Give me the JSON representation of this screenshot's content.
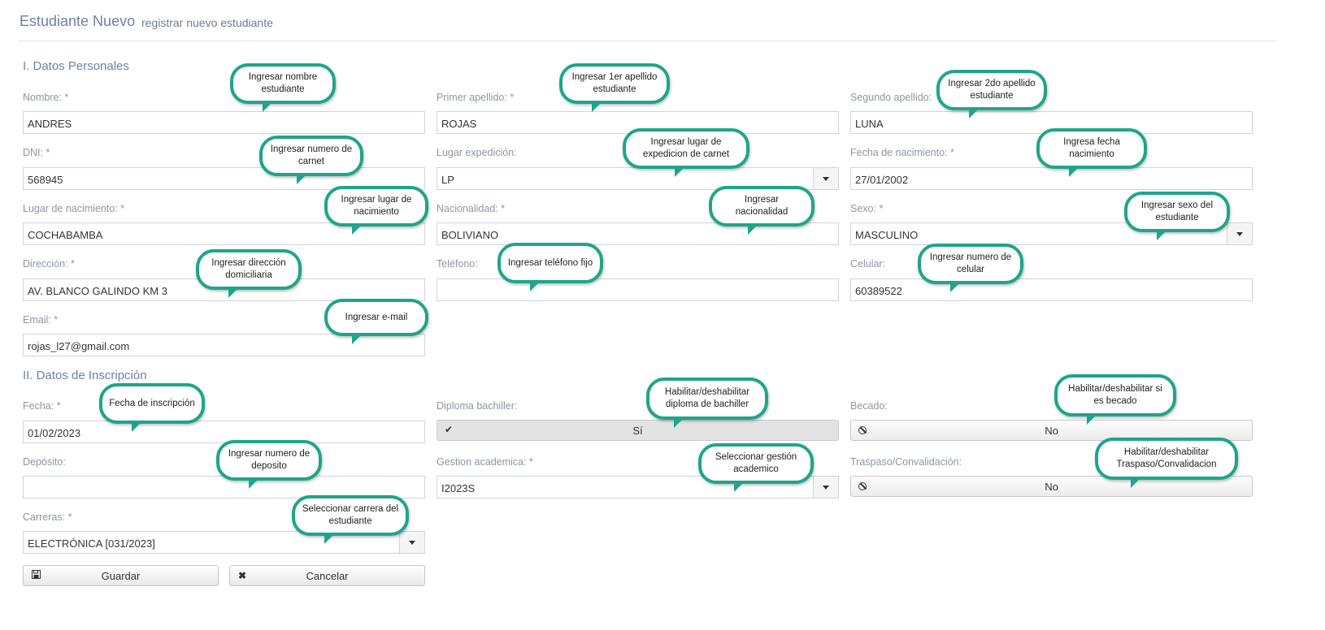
{
  "header": {
    "title": "Estudiante Nuevo",
    "subtitle": "registrar nuevo estudiante"
  },
  "sections": {
    "personal": "I. Datos Personales",
    "inscripcion": "II. Datos de Inscripción"
  },
  "fields": {
    "nombre": {
      "label": "Nombre: *",
      "value": "ANDRES"
    },
    "primer_apellido": {
      "label": "Primer apellido: *",
      "value": "ROJAS"
    },
    "segundo_apellido": {
      "label": "Segundo apellido:",
      "value": "LUNA"
    },
    "dni": {
      "label": "DNI: *",
      "value": "568945"
    },
    "lugar_expedicion": {
      "label": "Lugar expedición:",
      "value": "LP"
    },
    "fecha_nacimiento": {
      "label": "Fecha de nacimiento: *",
      "value": "27/01/2002"
    },
    "lugar_nacimiento": {
      "label": "Lugar de nacimiento: *",
      "value": "COCHABAMBA"
    },
    "nacionalidad": {
      "label": "Nacionalidad: *",
      "value": "BOLIVIANO"
    },
    "sexo": {
      "label": "Sexo: *",
      "value": "MASCULINO"
    },
    "direccion": {
      "label": "Dirección: *",
      "value": "AV. BLANCO GALINDO KM 3"
    },
    "telefono": {
      "label": "Teléfono:",
      "value": ""
    },
    "celular": {
      "label": "Celular:",
      "value": "60389522"
    },
    "email": {
      "label": "Email: *",
      "value": "rojas_l27@gmail.com"
    },
    "fecha": {
      "label": "Fecha: *",
      "value": "01/02/2023"
    },
    "diploma": {
      "label": "Diploma bachiller:",
      "value": "Sí"
    },
    "becado": {
      "label": "Becado:",
      "value": "No"
    },
    "deposito": {
      "label": "Depósito:",
      "value": ""
    },
    "gestion": {
      "label": "Gestion academica: *",
      "value": "I2023S"
    },
    "traspaso": {
      "label": "Traspaso/Convalidación:",
      "value": "No"
    },
    "carreras": {
      "label": "Carreras: *",
      "value": "ELECTRÓNICA [031/2023]"
    }
  },
  "buttons": {
    "guardar": "Guardar",
    "cancelar": "Cancelar"
  },
  "callouts": {
    "nombre": "Ingresar nombre estudiante",
    "primer_apellido": "Ingresar 1er apellido estudiante",
    "segundo_apellido": "Ingresar 2do apellido estudiante",
    "dni": "Ingresar numero de carnet",
    "lugar_expedicion": "Ingresar lugar de expedicion de carnet",
    "fecha_nacimiento": "Ingresa fecha nacimiento",
    "lugar_nacimiento": "Ingresar lugar de nacimiento",
    "nacionalidad": "Ingresar nacionalidad",
    "sexo": "Ingresar sexo del estudiante",
    "direccion": "Ingresar dirección domiciliaria",
    "telefono": "Ingresar teléfono fijo",
    "celular": "Ingresar numero de celular",
    "email": "Ingresar e-mail",
    "fecha": "Fecha de inscripción",
    "diploma": "Habilitar/deshabilitar diploma de bachiller",
    "becado": "Habilitar/deshabilitar si es becado",
    "deposito": "Ingresar numero de deposito",
    "gestion": "Seleccionar gestión academico",
    "traspaso": "Habilitar/deshabilitar Traspaso/Convalidacion",
    "carreras": "Seleccionar carrera del estudiante"
  },
  "colors": {
    "accent": "#1ea58b",
    "label": "#8c96a3",
    "title": "#6b82a8"
  }
}
